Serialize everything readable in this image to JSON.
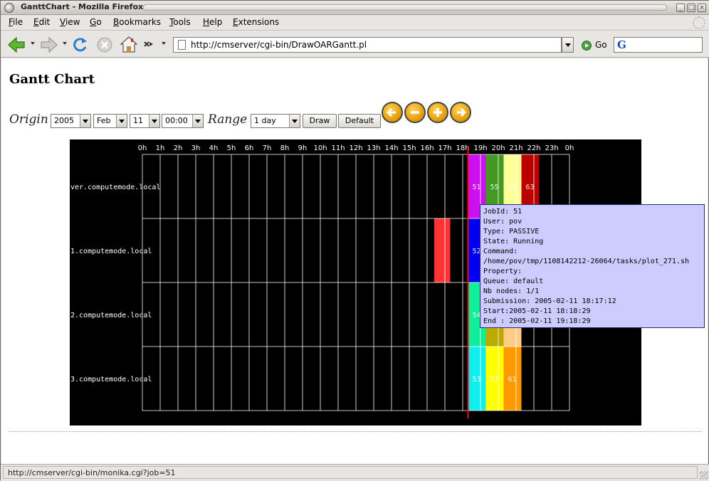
{
  "window": {
    "title": "GanttChart - Mozilla Firefox"
  },
  "menubar": [
    "File",
    "Edit",
    "View",
    "Go",
    "Bookmarks",
    "Tools",
    "Help",
    "Extensions"
  ],
  "toolbar": {
    "url": "http://cmserver/cgi-bin/DrawOARGantt.pl",
    "go_label": "Go",
    "search_engine_glyph": "G"
  },
  "page": {
    "title": "Gantt Chart",
    "origin_label": "Origin",
    "range_label": "Range",
    "year": "2005",
    "month": "Feb",
    "day": "11",
    "time": "00:00",
    "range": "1 day",
    "draw_button": "Draw",
    "default_button": "Default",
    "nav_icons": [
      "arrow-left-icon",
      "minus-icon",
      "plus-icon",
      "arrow-right-icon"
    ]
  },
  "chart_data": {
    "type": "gantt",
    "hours": [
      "0h",
      "1h",
      "2h",
      "3h",
      "4h",
      "5h",
      "6h",
      "7h",
      "8h",
      "9h",
      "10h",
      "11h",
      "12h",
      "13h",
      "14h",
      "15h",
      "16h",
      "17h",
      "18h",
      "19h",
      "20h",
      "21h",
      "22h",
      "23h",
      "0h"
    ],
    "rows": [
      "ver.computemode.local",
      "1.computemode.local",
      "2.computemode.local",
      "3.computemode.local"
    ],
    "current_time_hour": 18.3,
    "jobs": [
      {
        "row": 0,
        "start": 18.3,
        "end": 19.3,
        "color": "#cc11ee",
        "label": "51"
      },
      {
        "row": 0,
        "start": 19.3,
        "end": 20.3,
        "color": "#449922",
        "label": "55"
      },
      {
        "row": 0,
        "start": 20.3,
        "end": 21.3,
        "color": "#ffff99",
        "label": "59"
      },
      {
        "row": 0,
        "start": 21.3,
        "end": 22.3,
        "color": "#bb0000",
        "label": "63"
      },
      {
        "row": 1,
        "start": 16.4,
        "end": 17.3,
        "color": "#ff3333",
        "label": ""
      },
      {
        "row": 1,
        "start": 18.3,
        "end": 19.3,
        "color": "#0000ee",
        "label": "52"
      },
      {
        "row": 2,
        "start": 18.3,
        "end": 19.3,
        "color": "#11ee99",
        "label": "54"
      },
      {
        "row": 2,
        "start": 19.3,
        "end": 20.3,
        "color": "#bbaa00",
        "label": ""
      },
      {
        "row": 2,
        "start": 20.3,
        "end": 21.3,
        "color": "#ffcc88",
        "label": ""
      },
      {
        "row": 3,
        "start": 18.3,
        "end": 19.3,
        "color": "#11eeee",
        "label": "53"
      },
      {
        "row": 3,
        "start": 19.3,
        "end": 20.3,
        "color": "#ffff00",
        "label": "57"
      },
      {
        "row": 3,
        "start": 20.3,
        "end": 21.3,
        "color": "#ff9900",
        "label": "61"
      }
    ]
  },
  "tooltip": {
    "lines": [
      "JobId: 51",
      "User: pov",
      "Type: PASSIVE",
      "State: Running",
      "Command:",
      "/home/pov/tmp/1108142212-26064/tasks/plot_271.sh",
      "Property:",
      "Queue: default",
      "Nb nodes: 1/1",
      "Submission: 2005-02-11 18:17:12",
      "Start:2005-02-11 18:18:29",
      "End : 2005-02-11 19:18:29"
    ]
  },
  "status": {
    "text": "http://cmserver/cgi-bin/monika.cgi?job=51"
  }
}
